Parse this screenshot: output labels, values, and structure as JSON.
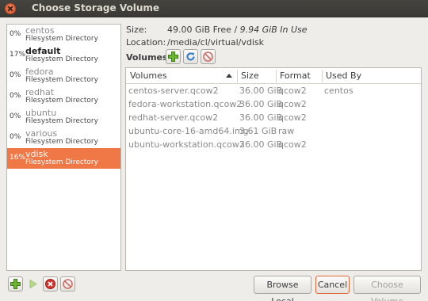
{
  "window": {
    "title": "Choose Storage Volume"
  },
  "pools": [
    {
      "percent": "0%",
      "name": "centos",
      "type": "Filesystem Directory",
      "active": false,
      "selected": false
    },
    {
      "percent": "17%",
      "name": "default",
      "type": "Filesystem Directory",
      "active": true,
      "selected": false
    },
    {
      "percent": "0%",
      "name": "fedora",
      "type": "Filesystem Directory",
      "active": false,
      "selected": false
    },
    {
      "percent": "0%",
      "name": "redhat",
      "type": "Filesystem Directory",
      "active": false,
      "selected": false
    },
    {
      "percent": "0%",
      "name": "ubuntu",
      "type": "Filesystem Directory",
      "active": false,
      "selected": false
    },
    {
      "percent": "0%",
      "name": "various",
      "type": "Filesystem Directory",
      "active": false,
      "selected": false
    },
    {
      "percent": "16%",
      "name": "vdisk",
      "type": "Filesystem Directory",
      "active": false,
      "selected": true
    }
  ],
  "info": {
    "size_label": "Size:",
    "free": "49.00 GiB Free /",
    "in_use": "9.94 GiB In Use",
    "location_label": "Location:",
    "location": "/media/cl/virtual/vdisk"
  },
  "volumes_label": "Volumes",
  "volume_toolbar": {
    "add_icon": "plus-icon",
    "refresh_icon": "refresh-icon",
    "delete_icon": "no-entry-icon"
  },
  "volume_table": {
    "headers": [
      "Volumes",
      "Size",
      "Format",
      "Used By"
    ],
    "rows": [
      {
        "name": "centos-server.qcow2",
        "size": "36.00 GiB",
        "format": "qcow2",
        "used_by": "centos"
      },
      {
        "name": "fedora-workstation.qcow2",
        "size": "36.00 GiB",
        "format": "qcow2",
        "used_by": ""
      },
      {
        "name": "redhat-server.qcow2",
        "size": "36.00 GiB",
        "format": "qcow2",
        "used_by": ""
      },
      {
        "name": "ubuntu-core-16-amd64.img",
        "size": "3.61 GiB",
        "format": "raw",
        "used_by": ""
      },
      {
        "name": "ubuntu-workstation.qcow2",
        "size": "36.00 GiB",
        "format": "qcow2",
        "used_by": ""
      }
    ]
  },
  "pool_toolbar": {
    "add_icon": "plus-icon",
    "start_icon": "play-icon",
    "stop_icon": "stop-icon",
    "delete_icon": "no-entry-icon"
  },
  "buttons": {
    "browse_local": "Browse Local",
    "cancel": "Cancel",
    "choose_volume": "Choose Volume"
  },
  "colors": {
    "selection": "#f07746",
    "add_green": "#5aa52a",
    "refresh_blue": "#3c7fc8",
    "delete_red": "#d0342c",
    "cancel_border": "#e0663c"
  }
}
